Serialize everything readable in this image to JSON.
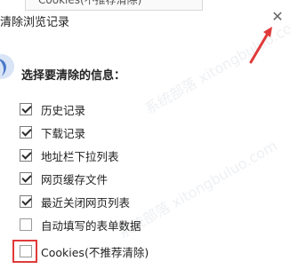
{
  "background_tab": {
    "label": "Cookies(不推荐清除)"
  },
  "dialog": {
    "title": "清除浏览记录",
    "prompt": "选择要清除的信息："
  },
  "options": [
    {
      "label": "历史记录",
      "checked": true
    },
    {
      "label": "下载记录",
      "checked": true
    },
    {
      "label": "地址栏下拉列表",
      "checked": true
    },
    {
      "label": "网页缓存文件",
      "checked": true
    },
    {
      "label": "最近关闭网页列表",
      "checked": true
    },
    {
      "label": "自动填写的表单数据",
      "checked": false
    },
    {
      "label": "Cookies(不推荐清除)",
      "checked": false
    }
  ],
  "icons": {
    "close": "close-icon",
    "arrow": "red-arrow-icon",
    "brand": "brand-icon"
  },
  "colors": {
    "accent_red": "#e03a3a",
    "icon_blue": "#4a78c8"
  },
  "watermark": "系统部落 xitongbuluo.com"
}
